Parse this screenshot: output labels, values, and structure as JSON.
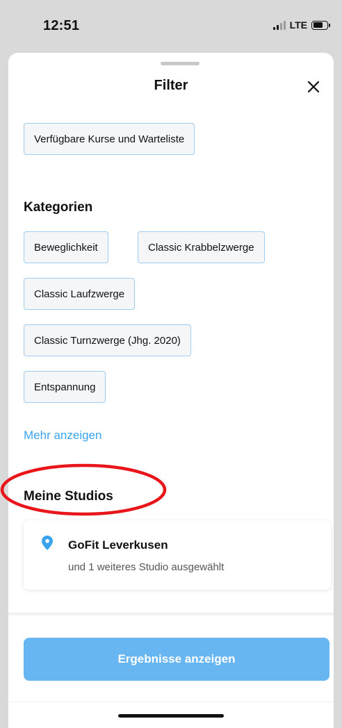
{
  "status_bar": {
    "time": "12:51",
    "network": "LTE"
  },
  "sheet": {
    "title": "Filter",
    "close_icon": "close-icon"
  },
  "availability": {
    "chip_label": "Verfügbare Kurse und Warteliste"
  },
  "categories": {
    "heading": "Kategorien",
    "items": [
      "Beweglichkeit",
      "Classic Krabbelzwerge",
      "Classic Laufzwerge",
      "Classic Turnzwerge (Jhg. 2020)",
      "Entspannung"
    ],
    "more_link": "Mehr anzeigen"
  },
  "studios": {
    "heading": "Meine Studios",
    "selected_name": "GoFit Leverkusen",
    "selected_info": "und 1 weiteres Studio ausgewählt",
    "icon": "location-pin-icon"
  },
  "footer": {
    "button_label": "Ergebnisse anzeigen"
  },
  "colors": {
    "accent": "#3aa3ee",
    "button": "#67b6f2",
    "chip_border": "#9fcdf1",
    "annotation": "#e8151b"
  }
}
